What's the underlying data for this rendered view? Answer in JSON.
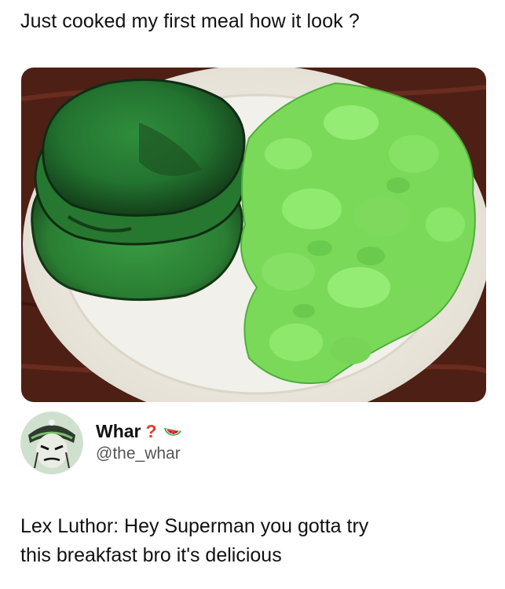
{
  "caption": "Just cooked my first meal how it look ?",
  "photo": {
    "subject": "green-pancakes-and-green-scrambled-eggs",
    "colors": {
      "table": "#5a2318",
      "plate": "#ece9e1",
      "pancake": "#2f8a3a",
      "eggs": "#7fe05e"
    }
  },
  "author": {
    "display_name": "Whar",
    "name_decoration": "?",
    "emoji_icon": "watermelon-icon",
    "handle": "@the_whar",
    "avatar_icon": "villain-avatar-icon"
  },
  "tweet": {
    "line1": "Lex Luthor: Hey Superman you gotta try",
    "line2": "this breakfast bro it's delicious"
  }
}
